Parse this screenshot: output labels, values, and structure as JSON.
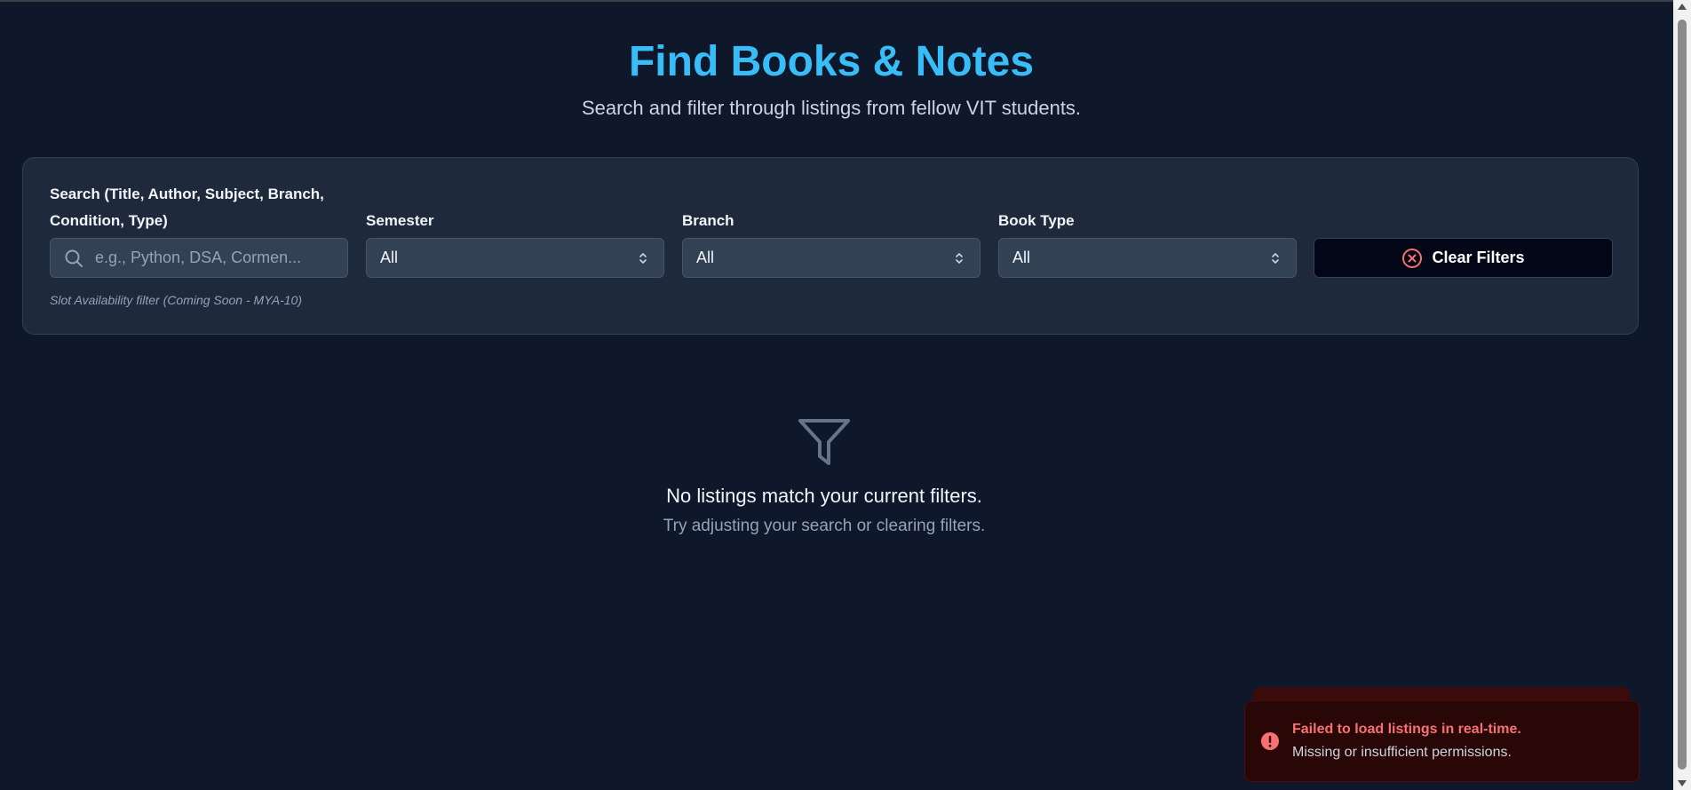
{
  "header": {
    "title": "Find Books & Notes",
    "subtitle": "Search and filter through listings from fellow VIT students."
  },
  "filters": {
    "search": {
      "label_line1": "Search (Title, Author, Subject, Branch,",
      "label_line2": "Condition, Type)",
      "placeholder": "e.g., Python, DSA, Cormen..."
    },
    "semester": {
      "label": "Semester",
      "value": "All"
    },
    "branch": {
      "label": "Branch",
      "value": "All"
    },
    "book_type": {
      "label": "Book Type",
      "value": "All"
    },
    "clear_label": "Clear Filters",
    "note": "Slot Availability filter (Coming Soon - MYA-10)"
  },
  "empty_state": {
    "icon": "funnel-icon",
    "message": "No listings match your current filters.",
    "hint": "Try adjusting your search or clearing filters."
  },
  "toast": {
    "icon": "alert-circle-icon",
    "title": "Failed to load listings in real-time.",
    "detail": "Missing or insufficient permissions."
  },
  "colors": {
    "background": "#0f172a",
    "accent": "#38bdf8",
    "card": "#1e293b",
    "error": "#f87171"
  }
}
